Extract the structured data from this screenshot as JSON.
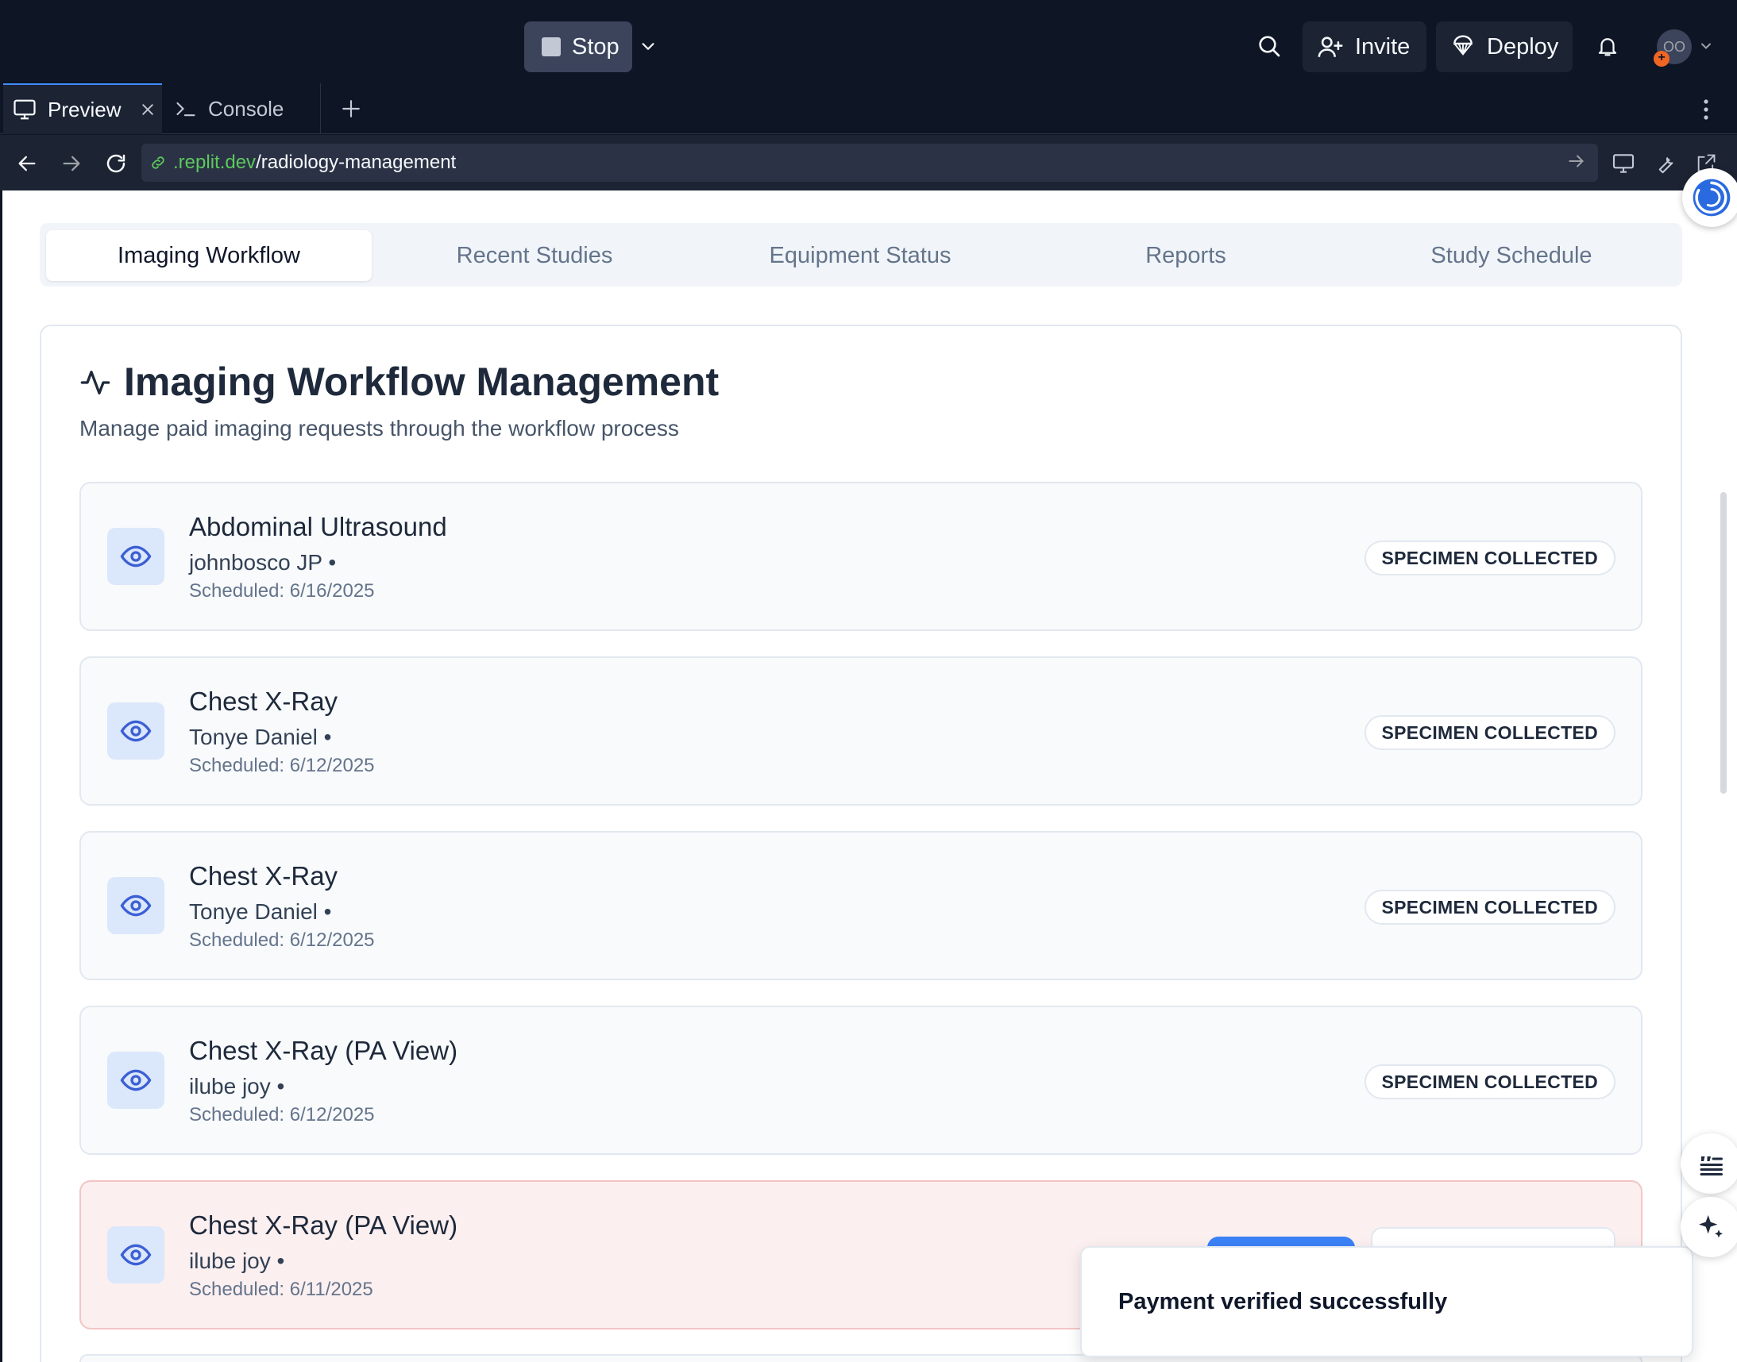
{
  "topbar": {
    "stop_label": "Stop",
    "invite_label": "Invite",
    "deploy_label": "Deploy",
    "avatar_initials": "OO"
  },
  "tabs": {
    "preview_label": "Preview",
    "console_label": "Console"
  },
  "address": {
    "domain": ".replit.dev",
    "path": "/radiology-management"
  },
  "page_tabs": [
    "Imaging Workflow",
    "Recent Studies",
    "Equipment Status",
    "Reports",
    "Study Schedule"
  ],
  "card": {
    "title": "Imaging Workflow Management",
    "description": "Manage paid imaging requests through the workflow process"
  },
  "requests": [
    {
      "title": "Abdominal Ultrasound",
      "patient": "johnbosco JP •",
      "scheduled": "Scheduled: 6/16/2025",
      "status": "SPECIMEN COLLECTED"
    },
    {
      "title": "Chest X-Ray",
      "patient": "Tonye Daniel •",
      "scheduled": "Scheduled: 6/12/2025",
      "status": "SPECIMEN COLLECTED"
    },
    {
      "title": "Chest X-Ray",
      "patient": "Tonye Daniel •",
      "scheduled": "Scheduled: 6/12/2025",
      "status": "SPECIMEN COLLECTED"
    },
    {
      "title": "Chest X-Ray (PA View)",
      "patient": "ilube joy •",
      "scheduled": "Scheduled: 6/12/2025",
      "status": "SPECIMEN COLLECTED"
    },
    {
      "title": "Chest X-Ray (PA View)",
      "patient": "ilube joy •",
      "scheduled": "Scheduled: 6/11/2025",
      "status": ""
    }
  ],
  "toast": {
    "message": "Payment verified successfully"
  },
  "colors": {
    "accent": "#3b82f6",
    "alert_bg": "#fbefef",
    "url_domain": "#5cc95c"
  },
  "icons": [
    "search-icon",
    "invite-icon",
    "deploy-icon",
    "bell-icon",
    "monitor-icon",
    "terminal-icon",
    "close-icon",
    "plus-icon",
    "back-icon",
    "forward-icon",
    "reload-icon",
    "link-icon",
    "pulse-icon",
    "eye-icon",
    "sparkle-icon",
    "quote-icon"
  ]
}
